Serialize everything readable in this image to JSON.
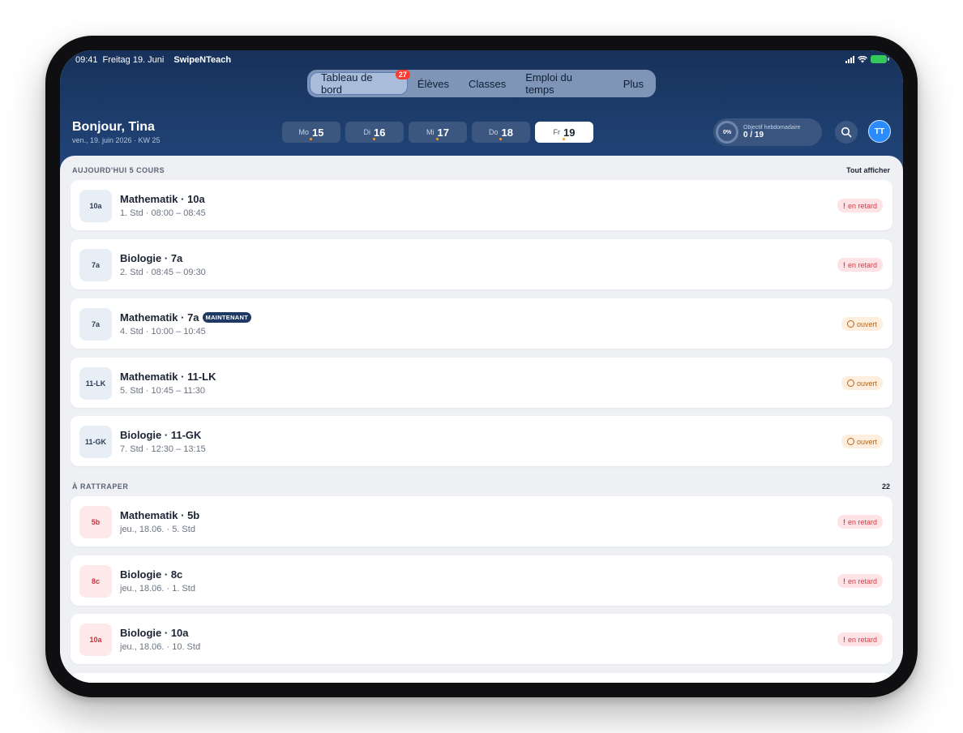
{
  "status_bar": {
    "time": "09:41",
    "date": "Freitag 19. Juni",
    "app": "SwipeNTeach"
  },
  "nav": {
    "items": [
      {
        "label": "Tableau de bord",
        "badge": "27",
        "active": true
      },
      {
        "label": "Élèves"
      },
      {
        "label": "Classes"
      },
      {
        "label": "Emploi du temps"
      },
      {
        "label": "Plus"
      }
    ]
  },
  "header": {
    "greeting": "Bonjour, Tina",
    "date_line": "ven., 19. juin 2026 · KW 25",
    "days": [
      {
        "wd": "Mo",
        "num": "15"
      },
      {
        "wd": "Di",
        "num": "16"
      },
      {
        "wd": "Mi",
        "num": "17"
      },
      {
        "wd": "Do",
        "num": "18"
      },
      {
        "wd": "Fr",
        "num": "19",
        "active": true
      }
    ],
    "goal": {
      "percent": "0%",
      "label": "Objectif hebdomadaire",
      "value": "0 / 19"
    },
    "avatar": "TT"
  },
  "today": {
    "title": "AUJOURD'HUI 5 COURS",
    "action": "Tout afficher",
    "items": [
      {
        "cls": "10a",
        "title": "Mathematik · 10a",
        "sub": "1. Std · 08:00 – 08:45",
        "status": "en retard",
        "status_type": "late"
      },
      {
        "cls": "7a",
        "title": "Biologie · 7a",
        "sub": "2. Std · 08:45 – 09:30",
        "status": "en retard",
        "status_type": "late"
      },
      {
        "cls": "7a",
        "title": "Mathematik · 7a",
        "sub": "4. Std · 10:00 – 10:45",
        "badge": "MAINTENANT",
        "status": "ouvert",
        "status_type": "open"
      },
      {
        "cls": "11-LK",
        "title": "Mathematik · 11-LK",
        "sub": "5. Std · 10:45 – 11:30",
        "status": "ouvert",
        "status_type": "open"
      },
      {
        "cls": "11-GK",
        "title": "Biologie · 11-GK",
        "sub": "7. Std · 12:30 – 13:15",
        "status": "ouvert",
        "status_type": "open"
      }
    ]
  },
  "catchup": {
    "title": "À RATTRAPER",
    "count": "22",
    "items": [
      {
        "cls": "5b",
        "title": "Mathematik · 5b",
        "sub": "jeu., 18.06. · 5. Std",
        "status": "en retard",
        "status_type": "late"
      },
      {
        "cls": "8c",
        "title": "Biologie · 8c",
        "sub": "jeu., 18.06. · 1. Std",
        "status": "en retard",
        "status_type": "late"
      },
      {
        "cls": "10a",
        "title": "Biologie · 10a",
        "sub": "jeu., 18.06. · 10. Std",
        "status": "en retard",
        "status_type": "late"
      }
    ]
  }
}
